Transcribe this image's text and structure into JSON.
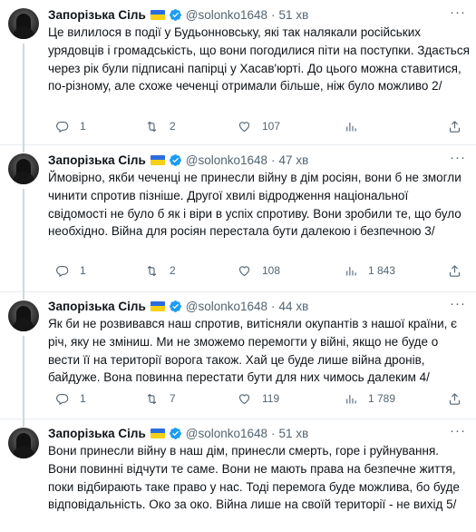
{
  "tweets": [
    {
      "name": "Запорізька Сіль",
      "handle": "@solonko1648",
      "time": "51 хв",
      "text": "Це вилилося в події у Будьонновську, які так налякали російських урядовців і громадськість, що вони погодилися піти на поступки. Здається через рік були підписані папірці у Хасав'юрті. До цього можна ставитися, по-різному, але схоже чеченці отримали більше, ніж було можливо 2/",
      "replies": "1",
      "retweets": "2",
      "likes": "107",
      "views": ""
    },
    {
      "name": "Запорізька Сіль",
      "handle": "@solonko1648",
      "time": "47 хв",
      "text": "Ймовірно, якби чеченці не принесли війну в дім росіян, вони б не змогли чинити спротив пізніше. Другої хвилі відродження національної свідомості не було б як і віри в успіх спротиву. Вони зробили те, що було необхідно. Війна для росіян перестала бути далекою і безпечною 3/",
      "replies": "1",
      "retweets": "2",
      "likes": "108",
      "views": "1 843"
    },
    {
      "name": "Запорізька Сіль",
      "handle": "@solonko1648",
      "time": "44 хв",
      "text": "Як би не розвивався наш спротив, витісняли окупантів з нашої країни, є річ, яку не зміниш. Ми не зможемо перемогти у війні, якщо не буде о вести її на території ворога також. Хай це буде лише війна дронів, байдуже. Вона повинна перестати бути для них чимось далеким 4/",
      "replies": "1",
      "retweets": "7",
      "likes": "119",
      "views": "1 789"
    },
    {
      "name": "Запорізька Сіль",
      "handle": "@solonko1648",
      "time": "51 хв",
      "text": "Вони принесли війну в наш дім, принесли смерть, горе і руйнування. Вони повинні відчути те саме. Вони не мають права на безпечне життя, поки відбирають таке право у нас. Тоді перемога буде можлива, бо буде відповідальність. Око за око. Війна лише на своїй території - не вихід 5/",
      "replies": "",
      "retweets": "",
      "likes": "",
      "views": ""
    }
  ],
  "icons": {
    "reply": "reply-icon",
    "retweet": "retweet-icon",
    "like": "heart-icon",
    "views": "views-icon",
    "share": "share-icon",
    "verified": "verified-badge-icon",
    "flag": "ukraine-flag-icon",
    "more": "more-options-icon"
  },
  "colors": {
    "verified": "#1d9bf0",
    "flag_blue": "#2a6ddf",
    "flag_yellow": "#f7d117",
    "secondary_text": "#536471"
  }
}
